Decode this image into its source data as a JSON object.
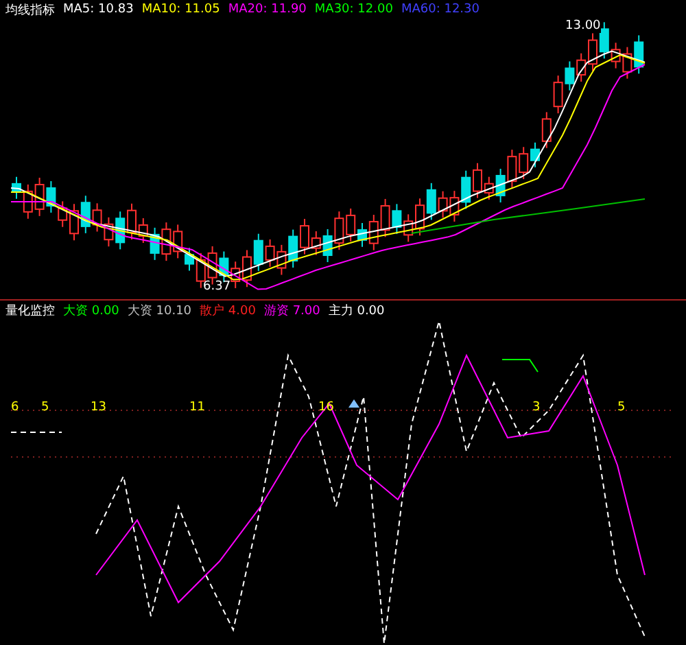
{
  "price_panel": {
    "title": "均线指标",
    "indicators": [
      {
        "label": "MA5: 10.83",
        "color": "#ffffff"
      },
      {
        "label": "MA10: 11.05",
        "color": "#ffff00"
      },
      {
        "label": "MA20: 11.90",
        "color": "#ff00ff"
      },
      {
        "label": "MA30: 12.00",
        "color": "#00ff00"
      },
      {
        "label": "MA60: 12.30",
        "color": "#4040ff"
      }
    ],
    "high_label": "13.00",
    "low_label": "6.37"
  },
  "indicator_panel": {
    "title": "量化监控",
    "indicators": [
      {
        "label": "大资 0.00",
        "color": "#00ff00"
      },
      {
        "label": "大资 10.10",
        "color": "#c0c0c0"
      },
      {
        "label": "散户 4.00",
        "color": "#ff2020"
      },
      {
        "label": "游资 7.00",
        "color": "#ff00ff"
      },
      {
        "label": "主力 0.00",
        "color": "#ffffff"
      }
    ],
    "marks": [
      "6",
      "5",
      "13",
      "11",
      "16",
      "3",
      "5"
    ]
  }
}
